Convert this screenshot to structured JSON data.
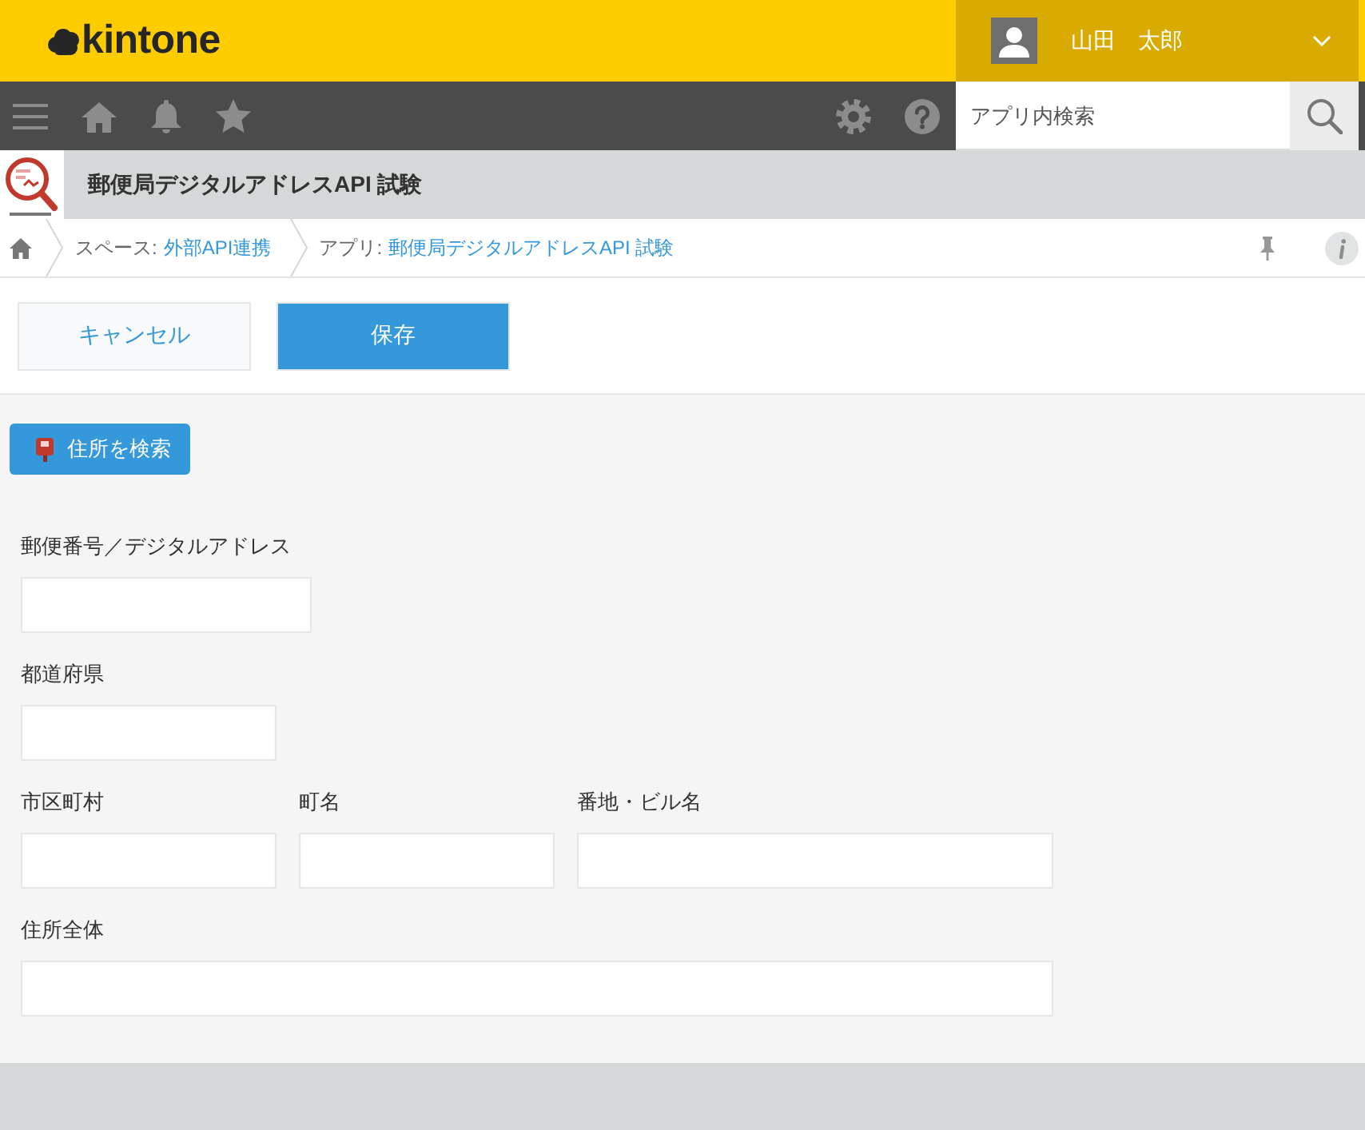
{
  "header": {
    "logo": "kintone",
    "user": {
      "name": "山田　太郎"
    }
  },
  "navbar": {
    "search": {
      "placeholder": "アプリ内検索"
    }
  },
  "app": {
    "title": "郵便局デジタルアドレスAPI 試験"
  },
  "breadcrumb": [
    {
      "label": "スペース:",
      "link": "外部API連携"
    },
    {
      "label": "アプリ:",
      "link": "郵便局デジタルアドレスAPI 試験"
    }
  ],
  "toolbar": {
    "buttons": [
      {
        "label": "キャンセル",
        "kind": "secondary"
      },
      {
        "label": "保存",
        "kind": "primary"
      }
    ]
  },
  "form": {
    "search_button": {
      "label": "住所を検索"
    },
    "rows": [
      [
        {
          "label": "郵便番号／デジタルアドレス"
        }
      ],
      [
        {
          "label": "都道府県"
        }
      ],
      [
        {
          "label": "市区町村"
        },
        {
          "label": "町名"
        },
        {
          "label": "番地・ビル名"
        }
      ],
      [
        {
          "label": "住所全体"
        }
      ]
    ]
  }
}
